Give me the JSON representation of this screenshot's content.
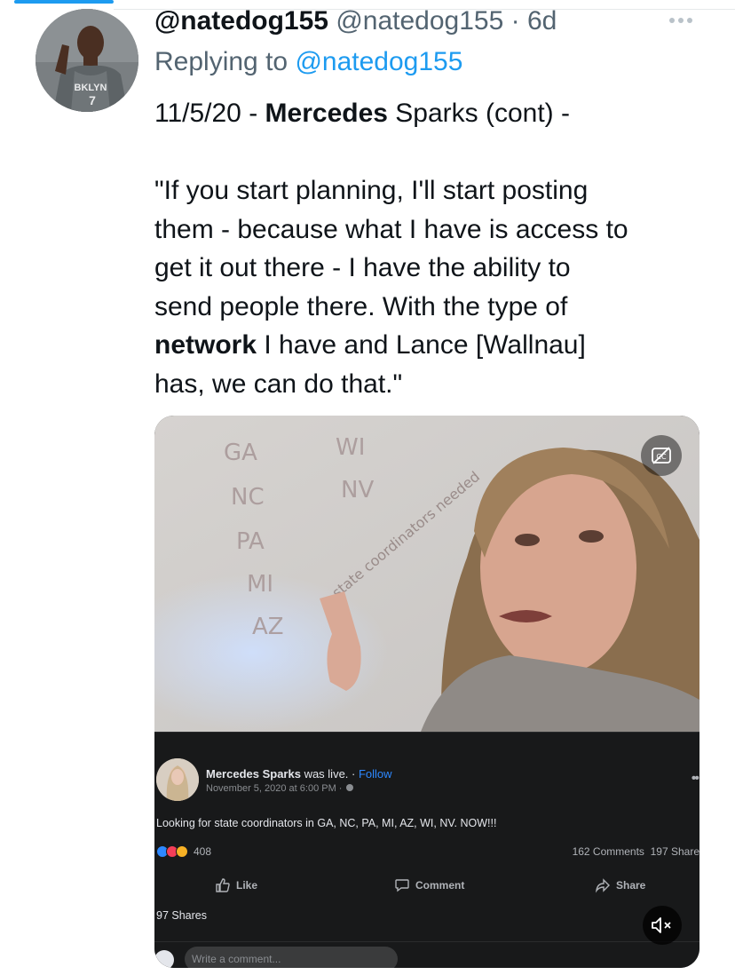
{
  "tweet": {
    "display_name": "@natedog155",
    "handle": "@natedog155",
    "separator": " · ",
    "age": "6d",
    "replying_prefix": "Replying to ",
    "replying_to": "@natedog155",
    "line1_a": "11/5/20 - ",
    "line1_b": "Mercedes",
    "line1_c": " Sparks (cont) -",
    "quote_line1": "\"If you start planning, I'll start posting",
    "quote_line2": "them - because what I have is access to",
    "quote_line3": "get it out there - I have the ability to",
    "quote_line4": "send people there. With the type of",
    "quote_line5_bold": "network",
    "quote_line5_rest": " I have and Lance [Wallnau]",
    "quote_line6": "has, we can do that.\""
  },
  "whiteboard": {
    "col1": [
      "GA",
      "NC",
      "PA",
      "MI",
      "AZ"
    ],
    "col2": [
      "WI",
      "NV"
    ],
    "note": "state coordinators needed"
  },
  "facebook": {
    "name": "Mercedes Sparks",
    "was_live": " was live.",
    "follow_sep": " · ",
    "follow": "Follow",
    "date": "November 5, 2020 at 6:00 PM ·",
    "post_text": "Looking for state coordinators in GA, NC, PA, MI, AZ, WI, NV. NOW!!!",
    "reaction_count": "408",
    "comments_count": "162 Comments",
    "shares_count": "197 Share",
    "like_label": "Like",
    "comment_label": "Comment",
    "share_label": "Share",
    "shares_text": "97 Shares",
    "comment_placeholder": "Write a comment..."
  },
  "icons": {
    "more": "more-horizontal-icon",
    "cc": "closed-captions-off-icon",
    "mute": "volume-muted-icon"
  },
  "colors": {
    "accent": "#1d9bf0",
    "facebook_blue": "#2d88ff"
  }
}
